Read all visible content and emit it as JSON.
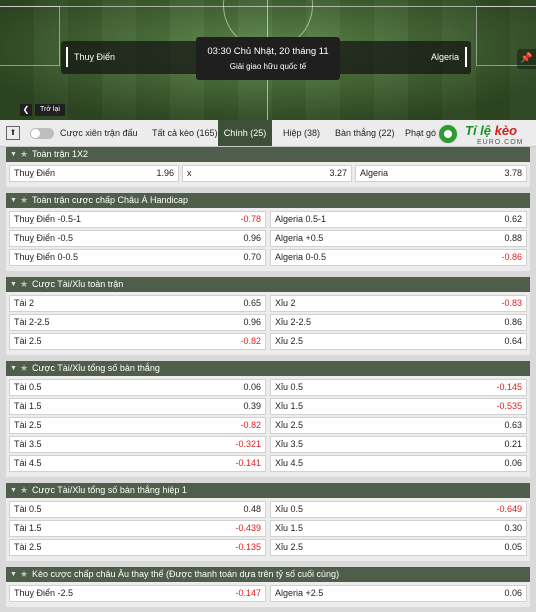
{
  "match": {
    "home": "Thuỵ Điển",
    "away": "Algeria",
    "time": "03:30 Chủ Nhật, 20 tháng 11",
    "league": "Giải giao hữu quốc tế"
  },
  "nav": {
    "back_label": "Trở lại",
    "back_icon": "chevron-left-icon",
    "collapse_icon": "double-chevron-up-icon",
    "pin_icon": "pin-icon"
  },
  "tabs": {
    "toggle_label": "Cược xiên trận đấu",
    "items": [
      {
        "label": "Tất cả kèo (165)"
      },
      {
        "label": "Chính (25)"
      },
      {
        "label": "Hiệp (38)"
      },
      {
        "label": "Bàn thắng (22)"
      },
      {
        "label": "Phạt gó"
      }
    ]
  },
  "logo": {
    "text_green": "Tỉ lệ ",
    "text_red": "kèo",
    "sub": "EURO.COM"
  },
  "colors": {
    "section_header": "#4f5e4b",
    "active_tab": "#3e5138",
    "negative_odd": "#e01d1d"
  },
  "sections": [
    {
      "title": "Toàn trận 1X2",
      "rows": [
        [
          {
            "name": "Thuỵ Điển",
            "odd": "1.96"
          },
          {
            "name": "x",
            "odd": "3.27"
          },
          {
            "name": "Algeria",
            "odd": "3.78"
          }
        ]
      ]
    },
    {
      "title": "Toàn trận cược chấp Châu Á Handicap",
      "rows": [
        [
          {
            "name": "Thuỵ Điển",
            "line": "-0.5-1",
            "odd": "-0.78"
          },
          {
            "name": "Algeria",
            "line": "0.5-1",
            "odd": "0.62"
          }
        ],
        [
          {
            "name": "Thuỵ Điển",
            "line": "-0.5",
            "odd": "0.96"
          },
          {
            "name": "Algeria",
            "line": "+0.5",
            "odd": "0.88"
          }
        ],
        [
          {
            "name": "Thuỵ Điển",
            "line": "0-0.5",
            "odd": "0.70"
          },
          {
            "name": "Algeria",
            "line": "0-0.5",
            "odd": "-0.86"
          }
        ]
      ]
    },
    {
      "title": "Cược Tài/Xỉu toàn trận",
      "rows": [
        [
          {
            "name": "Tài",
            "line": "2",
            "odd": "0.65"
          },
          {
            "name": "Xỉu",
            "line": "2",
            "odd": "-0.83"
          }
        ],
        [
          {
            "name": "Tài",
            "line": "2-2.5",
            "odd": "0.96"
          },
          {
            "name": "Xỉu",
            "line": "2-2.5",
            "odd": "0.86"
          }
        ],
        [
          {
            "name": "Tài",
            "line": "2.5",
            "odd": "-0.82"
          },
          {
            "name": "Xỉu",
            "line": "2.5",
            "odd": "0.64"
          }
        ]
      ]
    },
    {
      "title": "Cược Tài/Xỉu tổng số bàn thắng",
      "rows": [
        [
          {
            "name": "Tài",
            "line": "0.5",
            "odd": "0.06"
          },
          {
            "name": "Xỉu",
            "line": "0.5",
            "odd": "-0.145"
          }
        ],
        [
          {
            "name": "Tài",
            "line": "1.5",
            "odd": "0.39"
          },
          {
            "name": "Xỉu",
            "line": "1.5",
            "odd": "-0.535"
          }
        ],
        [
          {
            "name": "Tài",
            "line": "2.5",
            "odd": "-0.82"
          },
          {
            "name": "Xỉu",
            "line": "2.5",
            "odd": "0.63"
          }
        ],
        [
          {
            "name": "Tài",
            "line": "3.5",
            "odd": "-0.321"
          },
          {
            "name": "Xỉu",
            "line": "3.5",
            "odd": "0.21"
          }
        ],
        [
          {
            "name": "Tài",
            "line": "4.5",
            "odd": "-0.141"
          },
          {
            "name": "Xỉu",
            "line": "4.5",
            "odd": "0.06"
          }
        ]
      ]
    },
    {
      "title": "Cược Tài/Xỉu tổng số bàn thắng hiệp 1",
      "rows": [
        [
          {
            "name": "Tài",
            "line": "0.5",
            "odd": "0.48"
          },
          {
            "name": "Xỉu",
            "line": "0.5",
            "odd": "-0.649"
          }
        ],
        [
          {
            "name": "Tài",
            "line": "1.5",
            "odd": "-0.439"
          },
          {
            "name": "Xỉu",
            "line": "1.5",
            "odd": "0.30"
          }
        ],
        [
          {
            "name": "Tài",
            "line": "2.5",
            "odd": "-0.135"
          },
          {
            "name": "Xỉu",
            "line": "2.5",
            "odd": "0.05"
          }
        ]
      ]
    },
    {
      "title": "Kèo cược chấp châu Âu thay thế (Được thanh toán dựa trên tỷ số cuối cùng)",
      "rows": [
        [
          {
            "name": "Thuỵ Điển",
            "line": "-2.5",
            "odd": "-0.147"
          },
          {
            "name": "Algeria",
            "line": "+2.5",
            "odd": "0.06"
          }
        ]
      ]
    }
  ]
}
